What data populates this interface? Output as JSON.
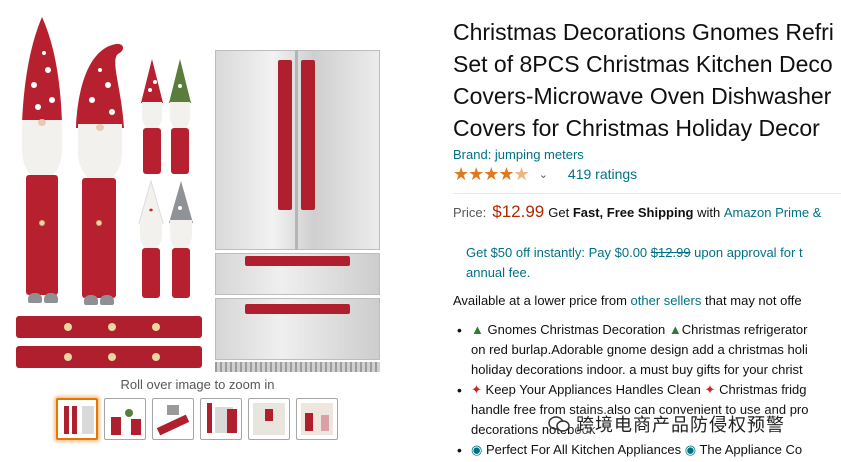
{
  "gallery": {
    "zoom_hint": "Roll over image to zoom in",
    "thumbnail_count": 6,
    "active_thumbnail": 1
  },
  "product": {
    "title_lines": [
      "Christmas Decorations Gnomes Refri",
      "Set of 8PCS Christmas Kitchen Deco",
      "Covers-Microwave Oven Dishwasher",
      "Covers for Christmas Holiday Decor"
    ],
    "brand": "Brand: jumping meters",
    "rating_stars": 4.5,
    "ratings_count": "419 ratings"
  },
  "pricing": {
    "price_label": "Price:",
    "price": "$12.99",
    "shipping_get": "Get",
    "shipping_bold": "Fast, Free Shipping",
    "shipping_with": "with",
    "shipping_link": "Amazon Prime &",
    "offer_line1_pre": "Get $50 off instantly: Pay $0.00",
    "offer_strike": "$12.99",
    "offer_line1_post": "upon approval for t",
    "offer_line2": "annual fee."
  },
  "availability": {
    "text_pre": "Available at a lower price from",
    "link": "other sellers",
    "text_post": "that may not offe"
  },
  "bullets": [
    {
      "line1": "Gnomes Christmas Decoration",
      "line1b": "Christmas refrigerator",
      "line2": "on red burlap.Adorable gnome design add a christmas holi",
      "line3": "holiday decorations indoor. a must buy gifts for your christ"
    },
    {
      "line1": "Keep Your Appliances Handles Clean",
      "line1b": "Christmas fridg",
      "line2": "handle free from stains.also can convenient to use and pro",
      "line3": "decorations notebook"
    },
    {
      "line1": "Perfect For All Kitchen Appliances",
      "line1b": "The Appliance Co"
    }
  ],
  "watermark": {
    "text": "跨境电商产品防侵权预警"
  },
  "colors": {
    "link": "#007185",
    "price": "#b12704",
    "star": "#de7921",
    "gnome_red": "#b7212f",
    "thumb_active_border": "#e77600"
  }
}
